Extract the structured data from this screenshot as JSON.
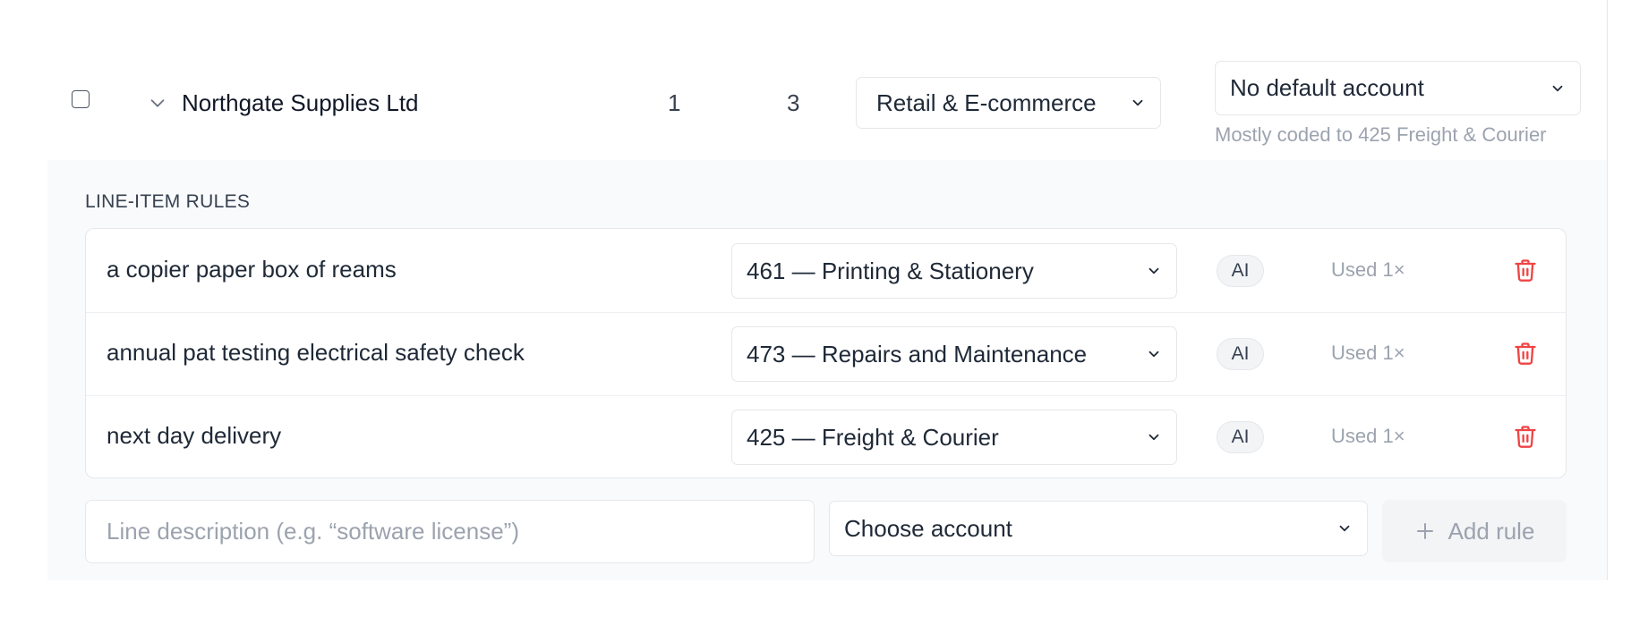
{
  "vendor": {
    "name": "Northgate Supplies Ltd",
    "count_a": "1",
    "count_b": "3",
    "industry": "Retail & E-commerce",
    "default_account": "No default account",
    "hint": "Mostly coded to 425 Freight & Courier"
  },
  "rules_section": {
    "title": "LINE-ITEM RULES",
    "rules": [
      {
        "description": "a copier paper box of reams",
        "account": "461 — Printing & Stationery",
        "badge": "AI",
        "usage": "Used 1×"
      },
      {
        "description": "annual pat testing electrical safety check",
        "account": "473 — Repairs and Maintenance",
        "badge": "AI",
        "usage": "Used 1×"
      },
      {
        "description": "next day delivery",
        "account": "425 — Freight & Courier",
        "badge": "AI",
        "usage": "Used 1×"
      }
    ]
  },
  "new_rule": {
    "placeholder": "Line description (e.g. “software license”)",
    "account_placeholder": "Choose account",
    "add_label": "Add rule"
  },
  "colors": {
    "delete_icon": "#ef4444",
    "panel_bg": "#f9fafb",
    "muted_text": "#9ca3af"
  },
  "icons": [
    "chevron-down-icon",
    "trash-icon",
    "plus-icon"
  ]
}
